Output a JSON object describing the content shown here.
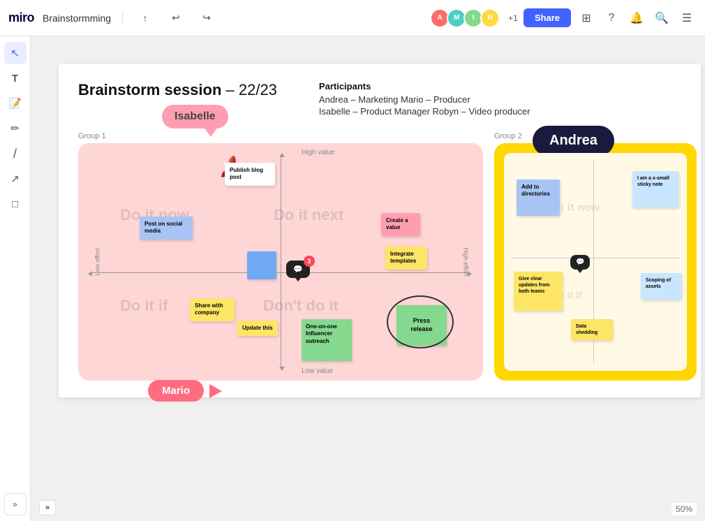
{
  "app": {
    "logo": "miro",
    "title": "Brainstormming"
  },
  "toolbar": {
    "share_label": "Share",
    "undo_icon": "↩",
    "redo_icon": "↪",
    "upload_icon": "↑",
    "zoom_icon": "⊞",
    "help_icon": "?",
    "bell_icon": "🔔",
    "search_icon": "🔍",
    "apps_icon": "⊞"
  },
  "participants": {
    "label": "Participants",
    "row1": "Andrea – Marketing   Mario – Producer",
    "row2": "Isabelle – Product Manager   Robyn – Video producer"
  },
  "board": {
    "title_bold": "Brainstorm session",
    "title_rest": " – 22/23"
  },
  "group1": {
    "label": "Group 1",
    "quad": {
      "do_it_now": "Do it now",
      "do_it_next": "Do it next",
      "do_it_if": "Do it if",
      "dont_do_it": "Don't do it"
    },
    "axis": {
      "high_value": "High value",
      "low_value": "Low value",
      "low_effort": "Low effort",
      "high_effort": "High effort"
    },
    "stickies": {
      "publish": "Publish blog post",
      "social": "Post on social media",
      "create": "Create a value",
      "integrate": "Integrate templates",
      "share": "Share with company",
      "update": "Update this",
      "press_release": "Press release",
      "one_on_one": "One-on-one Influencer outreach"
    },
    "isabelle": "Isabelle",
    "mario": "Mario",
    "chat_count": "3"
  },
  "group2": {
    "label": "Group 2",
    "quad": {
      "do_it_now": "Do it now",
      "do_it_if": "Do it if"
    },
    "stickies": {
      "add_dir": "Add to directories",
      "small": "I am a x-small sticky note",
      "give": "Give clear updates from both teams",
      "scoping": "Scoping of assets",
      "data": "Data shedding"
    },
    "andrea": "Andrea"
  },
  "zoom": {
    "level": "50%"
  },
  "avatars": [
    {
      "color": "#ff6b6b",
      "initials": "A"
    },
    {
      "color": "#4ecdc4",
      "initials": "M"
    },
    {
      "color": "#a8e6cf",
      "initials": "I"
    },
    {
      "color": "#ffd93d",
      "initials": "R"
    }
  ],
  "avatar_extra": "+1",
  "left_tools": [
    {
      "icon": "↖",
      "name": "select-tool",
      "active": true
    },
    {
      "icon": "T",
      "name": "text-tool"
    },
    {
      "icon": "🗒",
      "name": "note-tool"
    },
    {
      "icon": "✏",
      "name": "pen-tool"
    },
    {
      "icon": "/",
      "name": "line-tool"
    },
    {
      "icon": "↑",
      "name": "arrow-tool"
    },
    {
      "icon": "□",
      "name": "shape-tool"
    },
    {
      "icon": "»",
      "name": "more-tools"
    }
  ]
}
